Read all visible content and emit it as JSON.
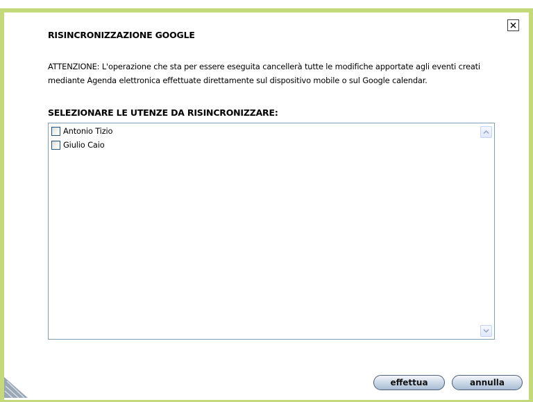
{
  "dialog": {
    "title": "RISINCRONIZZAZIONE GOOGLE",
    "warning": "ATTENZIONE: L'operazione che sta per essere eseguita cancellerà tutte le modifiche apportate agli eventi creati mediante Agenda elettronica effettuate direttamente sul dispositivo mobile o sul Google calendar.",
    "subtitle": "SELEZIONARE LE UTENZE DA RISINCRONIZZARE:",
    "users": [
      {
        "name": "Antonio Tizio",
        "checked": false
      },
      {
        "name": "Giulio Caio",
        "checked": false
      }
    ],
    "buttons": {
      "confirm": "effettua",
      "cancel": "annulla"
    }
  },
  "colors": {
    "frame_border": "#c3d97a",
    "listbox_border": "#7f9db9",
    "button_fill": "#a9bdd4"
  },
  "icons": {
    "close": "close-icon",
    "scroll_up": "chevron-up-icon",
    "scroll_down": "chevron-down-icon",
    "resize": "resize-grip-icon"
  }
}
